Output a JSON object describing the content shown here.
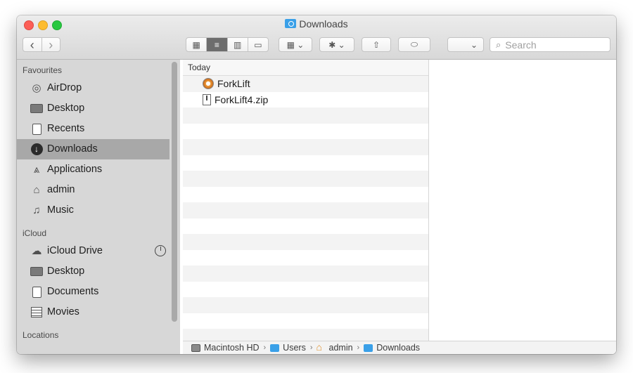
{
  "window": {
    "title": "Downloads"
  },
  "toolbar": {
    "back_glyph": "‹",
    "forward_glyph": "›",
    "views": [
      "▦",
      "≡",
      "▥",
      "▭"
    ],
    "group_glyph": "▦ ⌄",
    "action_glyph": "✱ ⌄",
    "share_glyph": "⇧",
    "tag_glyph": "⬭",
    "path_glyph": "⌄",
    "search_placeholder": "Search"
  },
  "sidebar": {
    "favourites_heading": "Favourites",
    "favourites": [
      {
        "label": "AirDrop",
        "icon": "airdrop-icon"
      },
      {
        "label": "Desktop",
        "icon": "desktop-icon"
      },
      {
        "label": "Recents",
        "icon": "recents-icon"
      },
      {
        "label": "Downloads",
        "icon": "downloads-icon",
        "selected": true
      },
      {
        "label": "Applications",
        "icon": "applications-icon"
      },
      {
        "label": "admin",
        "icon": "home-icon"
      },
      {
        "label": "Music",
        "icon": "music-icon"
      }
    ],
    "icloud_heading": "iCloud",
    "icloud": [
      {
        "label": "iCloud Drive",
        "icon": "cloud-icon"
      },
      {
        "label": "Desktop",
        "icon": "desktop-icon"
      },
      {
        "label": "Documents",
        "icon": "documents-icon"
      },
      {
        "label": "Movies",
        "icon": "movies-icon"
      }
    ],
    "locations_heading": "Locations"
  },
  "list": {
    "group_header": "Today",
    "files": [
      {
        "name": "ForkLift",
        "icon": "app-icon"
      },
      {
        "name": "ForkLift4.zip",
        "icon": "zip-icon"
      }
    ]
  },
  "pathbar": {
    "crumbs": [
      "Macintosh HD",
      "Users",
      "admin",
      "Downloads"
    ],
    "separator": "›"
  }
}
